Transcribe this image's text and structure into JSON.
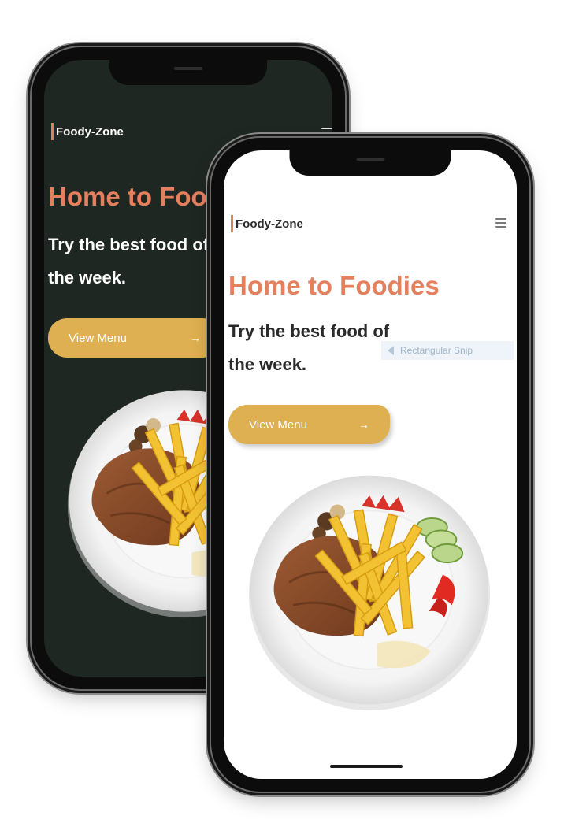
{
  "back_phone": {
    "theme": "dark",
    "bg_color": "#1f2722",
    "brand": "Foody-Zone",
    "menu_icon": "hamburger-menu-icon",
    "hero_title": "Home to Foodies",
    "hero_subtitle_line1": "Try the best food of",
    "hero_subtitle_line2": "the week.",
    "cta_label": "View Menu",
    "cta_icon": "arrow-right-icon",
    "cta_arrow": "→"
  },
  "front_phone": {
    "theme": "light",
    "bg_color": "#ffffff",
    "brand": "Foody-Zone",
    "menu_icon": "hamburger-menu-icon",
    "hero_title": "Home to Foodies",
    "hero_subtitle_line1": "Try the best food of",
    "hero_subtitle_line2": "the week.",
    "cta_label": "View Menu",
    "cta_icon": "arrow-right-icon",
    "cta_arrow": "→"
  },
  "overlay": {
    "snip_label": "Rectangular Snip"
  },
  "colors": {
    "accent": "#e5805f",
    "button": "#deb051",
    "dark_text": "#2a2a2a"
  }
}
